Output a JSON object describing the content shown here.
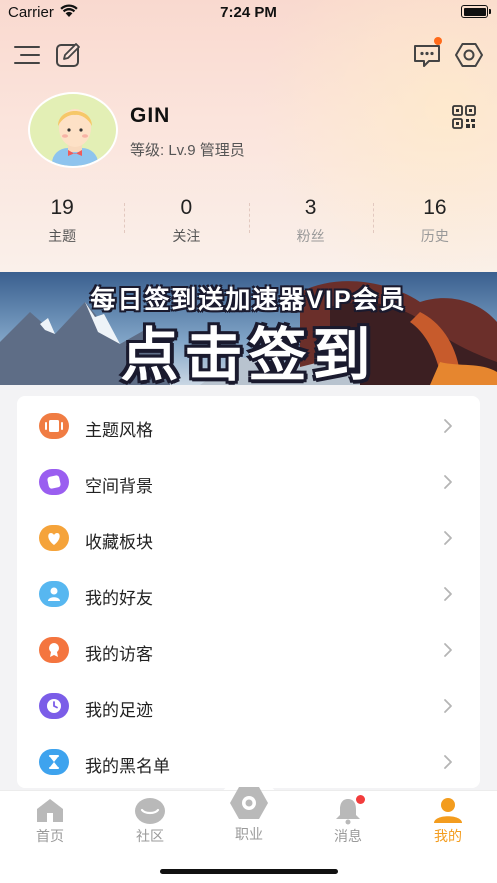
{
  "status_bar": {
    "carrier": "Carrier",
    "time": "7:24 PM"
  },
  "profile": {
    "username": "GIN",
    "level": "等级: Lv.9 管理员"
  },
  "stats": [
    {
      "value": "19",
      "label": "主题"
    },
    {
      "value": "0",
      "label": "关注"
    },
    {
      "value": "3",
      "label": "粉丝"
    },
    {
      "value": "16",
      "label": "历史"
    }
  ],
  "banner": {
    "line1": "每日签到送加速器VIP会员",
    "line2": "点击签到"
  },
  "menu": [
    {
      "label": "主题风格",
      "icon": "theme-icon",
      "color": "#f07c43"
    },
    {
      "label": "空间背景",
      "icon": "background-icon",
      "color": "#9a5ef0"
    },
    {
      "label": "收藏板块",
      "icon": "heart-icon",
      "color": "#f5a33a"
    },
    {
      "label": "我的好友",
      "icon": "friend-icon",
      "color": "#57b7f0"
    },
    {
      "label": "我的访客",
      "icon": "visitor-icon",
      "color": "#f4753f"
    },
    {
      "label": "我的足迹",
      "icon": "clock-icon",
      "color": "#7b5de8"
    },
    {
      "label": "我的黑名单",
      "icon": "hourglass-icon",
      "color": "#3ea3ee"
    }
  ],
  "tabbar": [
    {
      "label": "首页",
      "icon": "home-icon"
    },
    {
      "label": "社区",
      "icon": "community-icon"
    },
    {
      "label": "职业",
      "icon": "profession-icon"
    },
    {
      "label": "消息",
      "icon": "bell-icon"
    },
    {
      "label": "我的",
      "icon": "user-icon",
      "active": true
    }
  ],
  "colors": {
    "accent": "#f39c1e",
    "notification": "#ff6a1a"
  }
}
